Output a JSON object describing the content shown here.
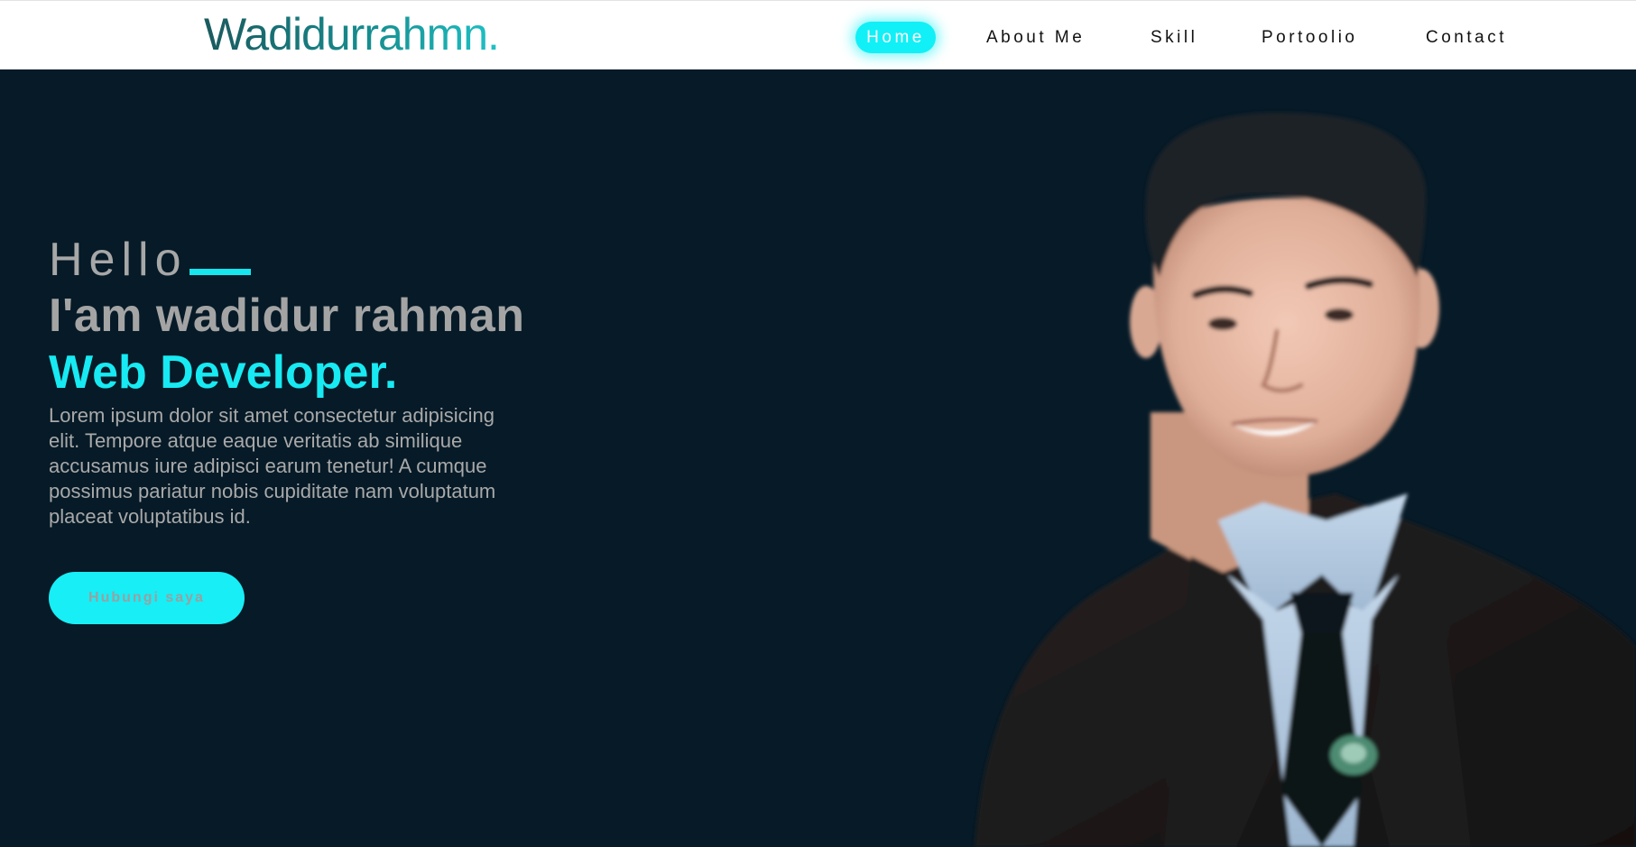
{
  "logo": "Wadidurrahmn.",
  "nav": {
    "home": "Home",
    "about": "About Me",
    "skill": "Skill",
    "portfolio": "Portoolio",
    "contact": "Contact"
  },
  "hero": {
    "greeting": "Hello",
    "name": "I'am wadidur rahman",
    "role": "Web Developer.",
    "description": "Lorem ipsum dolor sit amet consectetur adipisicing elit. Tempore atque eaque veritatis ab similique accusamus iure adipisci earum tenetur! A cumque possimus pariatur nobis cupiditate nam voluptatum placeat voluptatibus id.",
    "cta": "Hubungi saya"
  },
  "colors": {
    "accent": "#17eaf2",
    "background": "#061a27",
    "navbar": "#ffffff"
  }
}
